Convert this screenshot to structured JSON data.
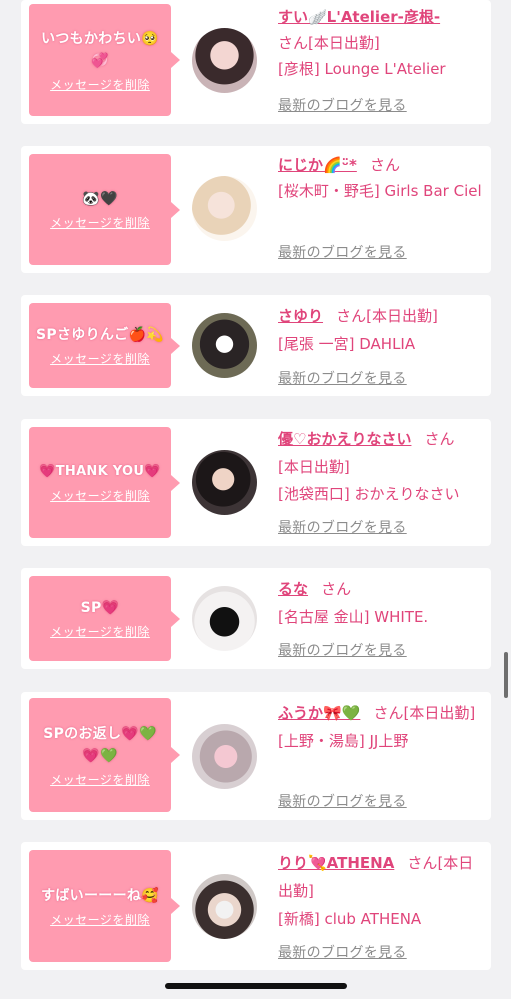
{
  "entries": [
    {
      "message": "いつもかわちい🥺💞",
      "delete_label": "メッセージを削除",
      "name": "すい🪽L'Atelier-彦根-",
      "honorific": "さん",
      "shift_status": "[本日出勤]",
      "area_shop": "[彦根] Lounge L'Atelier",
      "blog_link": "最新のブログを見る"
    },
    {
      "message": "🐼🖤",
      "delete_label": "メッセージを削除",
      "name": "にじか🌈ᵕ̈*",
      "honorific": "さん",
      "shift_status": "",
      "area_shop": "[桜木町・野毛] Girls Bar Ciel",
      "blog_link": "最新のブログを見る"
    },
    {
      "message": "SPさゆりんご🍎💫",
      "delete_label": "メッセージを削除",
      "name": "さゆり",
      "honorific": "さん",
      "shift_status": "[本日出勤]",
      "area_shop": "[尾張 一宮] DAHLIA",
      "blog_link": "最新のブログを見る"
    },
    {
      "message": "💗THANK YOU💗",
      "delete_label": "メッセージを削除",
      "name": "優♡おかえりなさい",
      "honorific": "さん",
      "shift_status": "[本日出勤]",
      "area_shop": "[池袋西口] おかえりなさい",
      "blog_link": "最新のブログを見る"
    },
    {
      "message": "SP💗",
      "delete_label": "メッセージを削除",
      "name": "るな",
      "honorific": "さん",
      "shift_status": "",
      "area_shop": "[名古屋 金山] WHITE.",
      "blog_link": "最新のブログを見る"
    },
    {
      "message": "SPのお返し💗💚💗💚",
      "delete_label": "メッセージを削除",
      "name": "ふうか🎀💚",
      "honorific": "さん",
      "shift_status": "[本日出勤]",
      "area_shop": "[上野・湯島] JJ上野",
      "blog_link": "最新のブログを見る"
    },
    {
      "message": "すばいーーーね🥰",
      "delete_label": "メッセージを削除",
      "name": "りり💘ATHENA",
      "honorific": "さん",
      "shift_status": "[本日出勤]",
      "area_shop": "[新橋] club ATHENA",
      "blog_link": "最新のブログを見る"
    }
  ],
  "colors": {
    "bubble": "#ff9bb0",
    "accent": "#e0457b",
    "muted": "#8c8c8c",
    "background": "#f1f1f3"
  }
}
